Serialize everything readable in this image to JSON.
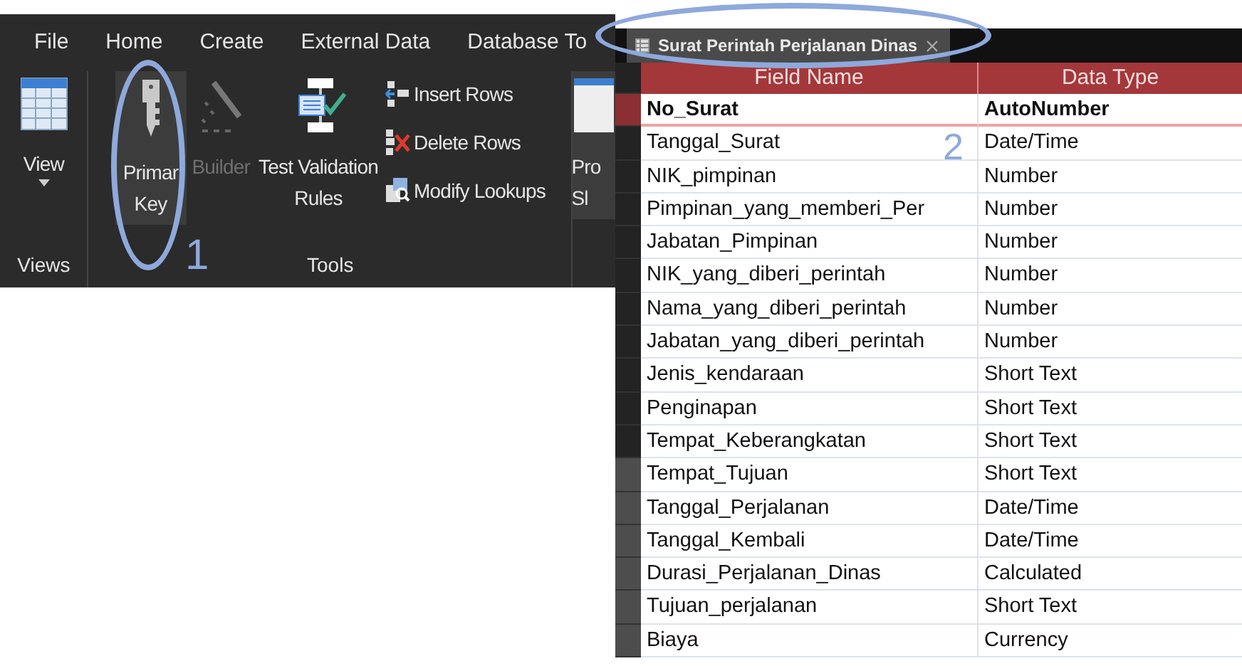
{
  "ribbon": {
    "tabs": [
      {
        "label": "File"
      },
      {
        "label": "Home"
      },
      {
        "label": "Create"
      },
      {
        "label": "External Data"
      },
      {
        "label": "Database To"
      }
    ],
    "buttons": [
      {
        "lines": [
          "View"
        ],
        "disabled": false
      },
      {
        "lines": [
          "Primar",
          "Key"
        ],
        "disabled": false
      },
      {
        "lines": [
          "Builder"
        ],
        "disabled": true
      },
      {
        "lines": [
          "Test Validation",
          "Rules"
        ],
        "disabled": false
      },
      {
        "lines": [
          "Pro",
          "Sl"
        ],
        "disabled": false
      }
    ],
    "small_buttons": [
      {
        "label": "Insert Rows"
      },
      {
        "label": "Delete Rows"
      },
      {
        "label": "Modify Lookups"
      }
    ],
    "groups": [
      {
        "label": "Views"
      },
      {
        "label": "Tools"
      }
    ]
  },
  "document_tab": {
    "title": "Surat Perintah Perjalanan Dinas"
  },
  "table": {
    "columns": [
      "Field Name",
      "Data Type"
    ],
    "rows": [
      {
        "field_name": "No_Surat",
        "data_type": "AutoNumber",
        "selected": true
      },
      {
        "field_name": "Tanggal_Surat",
        "data_type": "Date/Time",
        "selected": false
      },
      {
        "field_name": "NIK_pimpinan",
        "data_type": "Number",
        "selected": false
      },
      {
        "field_name": "Pimpinan_yang_memberi_Per",
        "data_type": "Number",
        "selected": false
      },
      {
        "field_name": "Jabatan_Pimpinan",
        "data_type": "Number",
        "selected": false
      },
      {
        "field_name": "NIK_yang_diberi_perintah",
        "data_type": "Number",
        "selected": false
      },
      {
        "field_name": "Nama_yang_diberi_perintah",
        "data_type": "Number",
        "selected": false
      },
      {
        "field_name": "Jabatan_yang_diberi_perintah",
        "data_type": "Number",
        "selected": false
      },
      {
        "field_name": "Jenis_kendaraan",
        "data_type": "Short Text",
        "selected": false
      },
      {
        "field_name": "Penginapan",
        "data_type": "Short Text",
        "selected": false
      },
      {
        "field_name": "Tempat_Keberangkatan",
        "data_type": "Short Text",
        "selected": false
      },
      {
        "field_name": "Tempat_Tujuan",
        "data_type": "Short Text",
        "selected": false
      },
      {
        "field_name": "Tanggal_Perjalanan",
        "data_type": "Date/Time",
        "selected": false
      },
      {
        "field_name": "Tanggal_Kembali",
        "data_type": "Date/Time",
        "selected": false
      },
      {
        "field_name": "Durasi_Perjalanan_Dinas",
        "data_type": "Calculated",
        "selected": false
      },
      {
        "field_name": "Tujuan_perjalanan",
        "data_type": "Short Text",
        "selected": false
      },
      {
        "field_name": "Biaya",
        "data_type": "Currency",
        "selected": false
      }
    ]
  },
  "annotations": [
    {
      "label": "1"
    },
    {
      "label": "2"
    }
  ]
}
